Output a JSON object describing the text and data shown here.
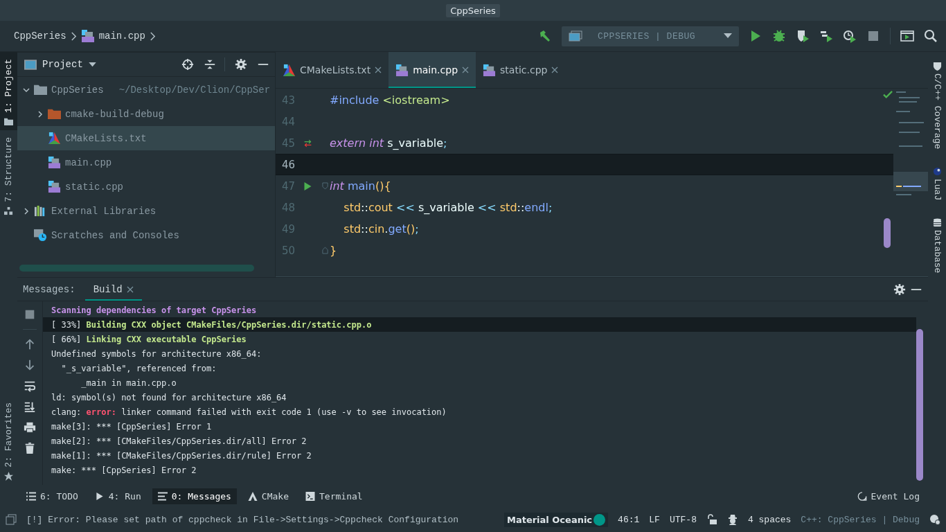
{
  "window": {
    "title": "CppSeries"
  },
  "breadcrumb": [
    {
      "label": "CppSeries",
      "kind": "project"
    },
    {
      "label": "main.cpp",
      "kind": "cpp"
    }
  ],
  "run_config": {
    "label": "CPPSERIES | DEBUG"
  },
  "left_strip": [
    {
      "label": "1: Project",
      "kind": "folder",
      "selected": true
    },
    {
      "label": "7: Structure",
      "kind": "structure",
      "selected": false
    }
  ],
  "left_strip_bottom": [
    {
      "label": "2: Favorites",
      "kind": "star",
      "selected": false
    }
  ],
  "project": {
    "title": "Project",
    "tree": [
      {
        "label": "CppSeries",
        "path": "~/Desktop/Dev/Clion/CppSer",
        "kind": "folder",
        "expanded": true,
        "selected": false,
        "children": [
          {
            "label": "cmake-build-debug",
            "kind": "build-folder",
            "expanded": false,
            "selected": false
          },
          {
            "label": "CMakeLists.txt",
            "kind": "cmake",
            "selected": true
          },
          {
            "label": "main.cpp",
            "kind": "cpp",
            "selected": false
          },
          {
            "label": "static.cpp",
            "kind": "cpp",
            "selected": false
          }
        ]
      },
      {
        "label": "External Libraries",
        "kind": "libraries",
        "expanded": false,
        "selected": false
      },
      {
        "label": "Scratches and Consoles",
        "kind": "scratches",
        "selected": false
      }
    ]
  },
  "editor": {
    "tabs": [
      {
        "label": "CMakeLists.txt",
        "kind": "cmake",
        "selected": false
      },
      {
        "label": "main.cpp",
        "kind": "cpp",
        "selected": true
      },
      {
        "label": "static.cpp",
        "kind": "cpp",
        "selected": false
      }
    ],
    "lines": [
      {
        "number": "43",
        "current": false,
        "tokens": [
          {
            "text": "#include",
            "kind": "macro"
          },
          {
            "text": " <iostream>",
            "kind": "string"
          }
        ]
      },
      {
        "number": "44",
        "current": false
      },
      {
        "number": "45",
        "current": false,
        "gutter": {
          "kind": "override"
        },
        "tokens": [
          {
            "text": "extern ",
            "kind": "keyword"
          },
          {
            "text": "int ",
            "kind": "keyword"
          },
          {
            "text": "s_variable",
            "kind": "plain"
          },
          {
            "text": ";",
            "kind": "punct"
          }
        ]
      },
      {
        "number": "46",
        "current": true
      },
      {
        "number": "47",
        "current": false,
        "gutter": {
          "kind": "run"
        },
        "fold": {
          "kind": "start"
        },
        "tokens": [
          {
            "text": "int ",
            "kind": "keyword"
          },
          {
            "text": "main",
            "kind": "function"
          },
          {
            "text": "(){",
            "kind": "brace"
          }
        ]
      },
      {
        "number": "48",
        "current": false,
        "tokens": [
          {
            "text": "    std",
            "kind": "namespace"
          },
          {
            "text": "::",
            "kind": "plain"
          },
          {
            "text": "cout ",
            "kind": "namespace"
          },
          {
            "text": "<< ",
            "kind": "operator"
          },
          {
            "text": "s_variable ",
            "kind": "plain"
          },
          {
            "text": "<< ",
            "kind": "operator"
          },
          {
            "text": "std",
            "kind": "namespace"
          },
          {
            "text": "::",
            "kind": "plain"
          },
          {
            "text": "endl",
            "kind": "function"
          },
          {
            "text": ";",
            "kind": "punct"
          }
        ]
      },
      {
        "number": "49",
        "current": false,
        "tokens": [
          {
            "text": "    std",
            "kind": "namespace"
          },
          {
            "text": "::",
            "kind": "plain"
          },
          {
            "text": "cin",
            "kind": "namespace"
          },
          {
            "text": ".",
            "kind": "plain"
          },
          {
            "text": "get",
            "kind": "function"
          },
          {
            "text": "()",
            "kind": "brace"
          },
          {
            "text": ";",
            "kind": "punct"
          }
        ]
      },
      {
        "number": "50",
        "current": false,
        "fold": {
          "kind": "end"
        },
        "tokens": [
          {
            "text": "}",
            "kind": "brace"
          }
        ]
      }
    ]
  },
  "right_strip": [
    {
      "label": "C/C++ Coverage",
      "kind": "shield"
    },
    {
      "label": "LuaJ",
      "kind": "lua"
    },
    {
      "label": "Database",
      "kind": "database"
    }
  ],
  "messages": {
    "label": "Messages:",
    "tabs": [
      {
        "label": "Build",
        "selected": true
      }
    ],
    "lines": [
      {
        "selected": false,
        "segments": [
          {
            "text": "Scanning dependencies of target CppSeries",
            "kind": "heading"
          }
        ]
      },
      {
        "selected": true,
        "segments": [
          {
            "text": "[ 33%] ",
            "kind": "plain"
          },
          {
            "text": "Building CXX object CMakeFiles/CppSeries.dir/static.cpp.o",
            "kind": "success"
          }
        ]
      },
      {
        "selected": false,
        "segments": [
          {
            "text": "[ 66%] ",
            "kind": "plain"
          },
          {
            "text": "Linking CXX executable CppSeries",
            "kind": "success"
          }
        ]
      },
      {
        "selected": false,
        "segments": [
          {
            "text": "Undefined symbols for architecture x86_64:",
            "kind": "plain"
          }
        ]
      },
      {
        "selected": false,
        "segments": [
          {
            "text": "  \"_s_variable\", referenced from:",
            "kind": "plain"
          }
        ]
      },
      {
        "selected": false,
        "segments": [
          {
            "text": "      _main in main.cpp.o",
            "kind": "plain"
          }
        ]
      },
      {
        "selected": false,
        "segments": [
          {
            "text": "ld: symbol(s) not found for architecture x86_64",
            "kind": "plain"
          }
        ]
      },
      {
        "selected": false,
        "segments": [
          {
            "text": "clang: ",
            "kind": "plain"
          },
          {
            "text": "error:",
            "kind": "error"
          },
          {
            "text": " linker command failed with exit code 1 (use -v to see invocation)",
            "kind": "plain"
          }
        ]
      },
      {
        "selected": false,
        "segments": [
          {
            "text": "make[3]: *** [CppSeries] Error 1",
            "kind": "plain"
          }
        ]
      },
      {
        "selected": false,
        "segments": [
          {
            "text": "make[2]: *** [CMakeFiles/CppSeries.dir/all] Error 2",
            "kind": "plain"
          }
        ]
      },
      {
        "selected": false,
        "segments": [
          {
            "text": "make[1]: *** [CMakeFiles/CppSeries.dir/rule] Error 2",
            "kind": "plain"
          }
        ]
      },
      {
        "selected": false,
        "segments": [
          {
            "text": "make: *** [CppSeries] Error 2",
            "kind": "plain"
          }
        ]
      }
    ]
  },
  "tool_tabs": [
    {
      "label": "6: TODO",
      "kind": "todo",
      "selected": false
    },
    {
      "label": "4: Run",
      "kind": "run",
      "selected": false
    },
    {
      "label": "0: Messages",
      "kind": "messages",
      "selected": true
    },
    {
      "label": "CMake",
      "kind": "cmake",
      "selected": false
    },
    {
      "label": "Terminal",
      "kind": "terminal",
      "selected": false
    }
  ],
  "event_log": {
    "label": "Event Log"
  },
  "status_bar": {
    "message": "[!] Error: Please set path of cppcheck in File->Settings->Cppcheck Configuration",
    "theme": {
      "label": "Material Oceanic",
      "color": "#009688"
    },
    "position": "46:1",
    "line_separator": "LF",
    "encoding": "UTF-8",
    "indent": "4 spaces",
    "context": "C++: CppSeries | Debug"
  }
}
